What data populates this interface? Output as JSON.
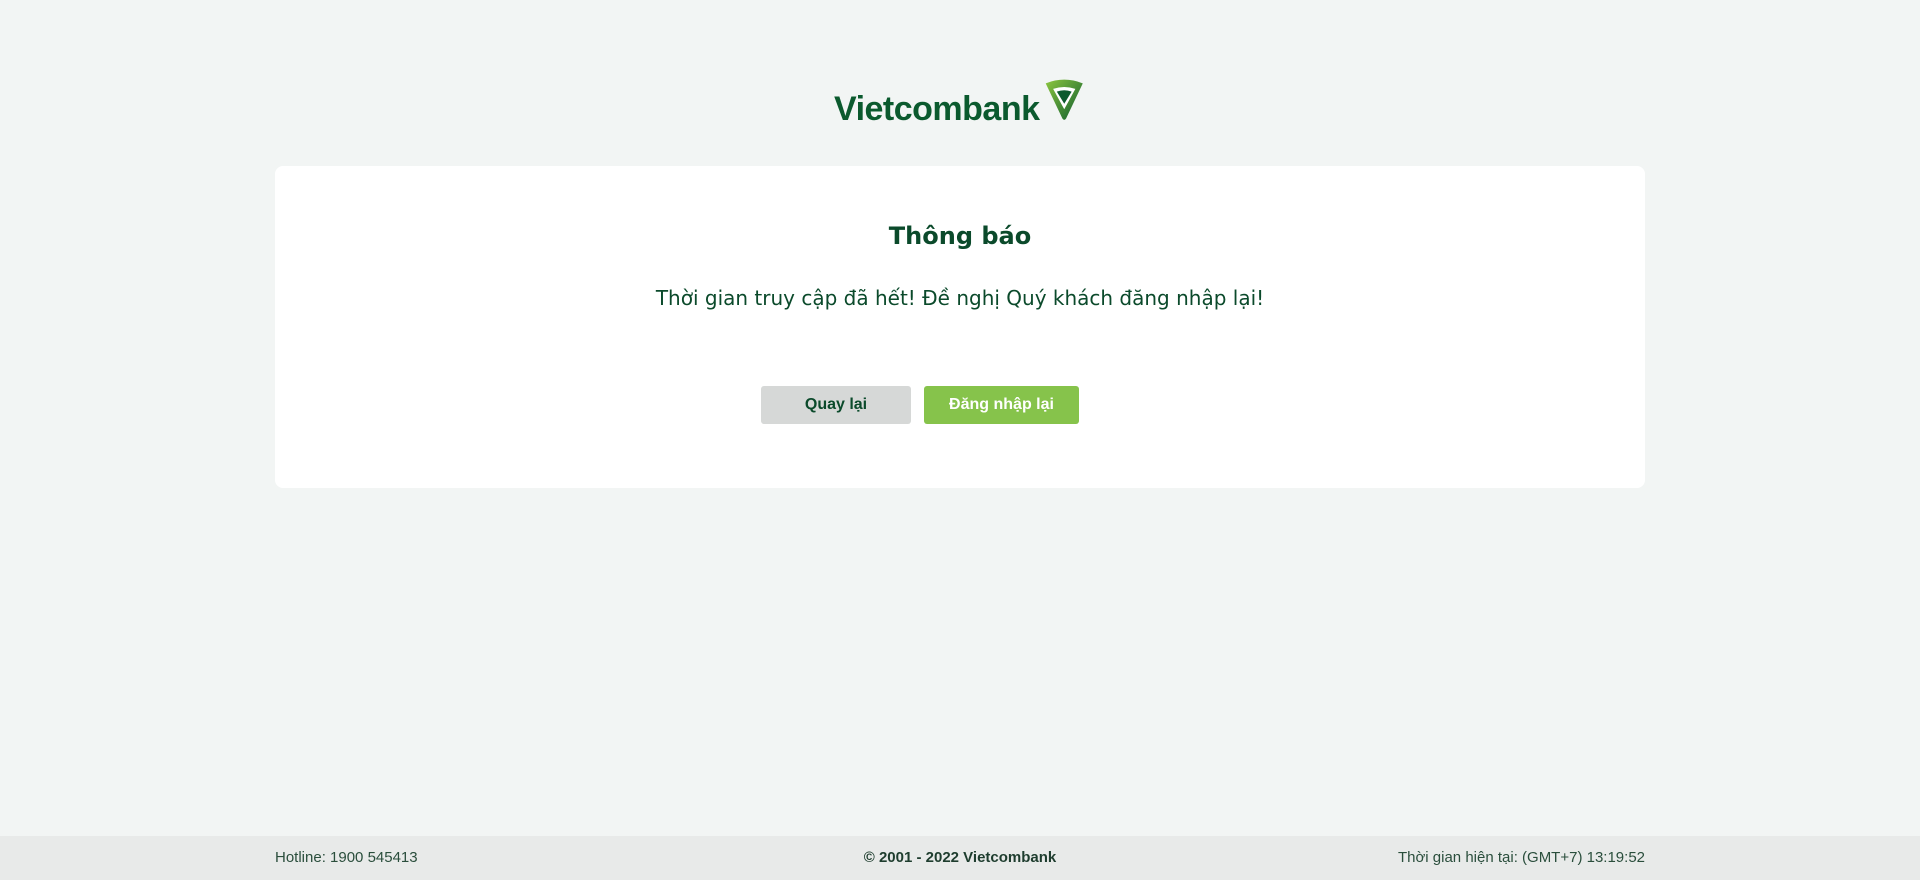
{
  "brand": {
    "name": "Vietcombank",
    "colors": {
      "primary_dark_green": "#0b5a2e",
      "accent_light_green": "#86c34b",
      "background": "#f2f5f4"
    }
  },
  "notice": {
    "title": "Thông báo",
    "message": "Thời gian truy cập đã hết! Đề nghị Quý khách đăng nhập lại!",
    "back_button_label": "Quay lại",
    "login_button_label": "Đăng nhập lại"
  },
  "footer": {
    "hotline": "Hotline: 1900 545413",
    "copyright": "© 2001 - 2022 Vietcombank",
    "current_time": "Thời gian hiện tại: (GMT+7) 13:19:52"
  }
}
